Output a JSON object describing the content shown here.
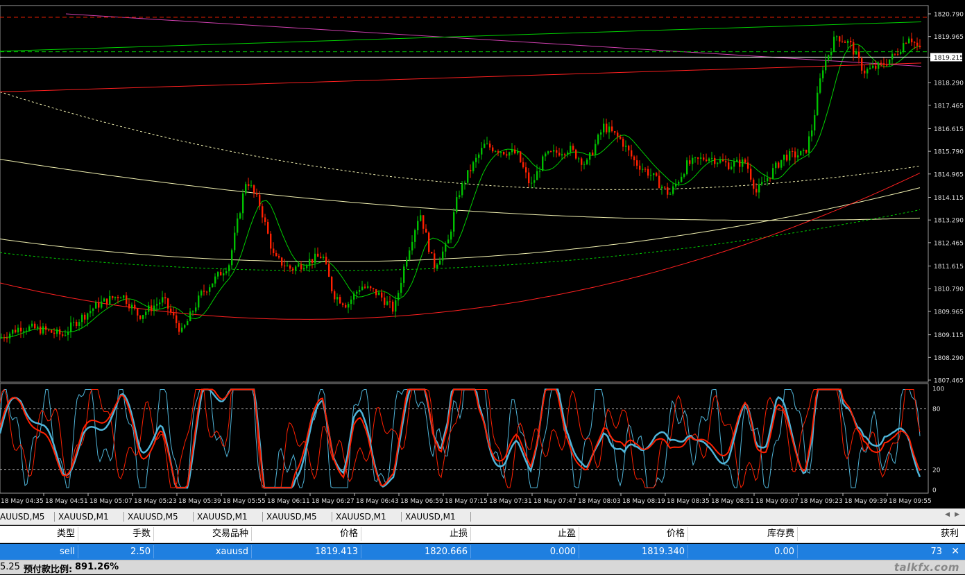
{
  "window": {
    "title": "XAUUSD,M1"
  },
  "colors": {
    "background": "#000000",
    "bull": "#00c000",
    "bear": "#ff2000",
    "ma_fast": "#00d000",
    "ma_slow": "#ff2020",
    "ma_yellow": "#f0f0b0",
    "magenta": "#d040b0",
    "signal": "#4fb4d8",
    "grid_header_bg": "#ffffff",
    "selected_row": "#1f7fe0"
  },
  "price_axis": {
    "labels": [
      "1820.790",
      "1819.965",
      "1819.215",
      "1818.290",
      "1817.465",
      "1816.615",
      "1815.790",
      "1814.965",
      "1814.115",
      "1813.290",
      "1812.465",
      "1811.615",
      "1810.790",
      "1809.965",
      "1809.115",
      "1808.290",
      "1807.465"
    ],
    "current_price": "1819.215"
  },
  "oscillator_axis": {
    "labels": [
      "100",
      "80",
      "20",
      "0"
    ]
  },
  "time_axis": {
    "labels": [
      "18 May 04:35",
      "18 May 04:51",
      "18 May 05:07",
      "18 May 05:23",
      "18 May 05:39",
      "18 May 05:55",
      "18 May 06:11",
      "18 May 06:27",
      "18 May 06:43",
      "18 May 06:59",
      "18 May 07:15",
      "18 May 07:31",
      "18 May 07:47",
      "18 May 08:03",
      "18 May 08:19",
      "18 May 08:35",
      "18 May 08:51",
      "18 May 09:07",
      "18 May 09:23",
      "18 May 09:39",
      "18 May 09:55"
    ]
  },
  "chart_data": {
    "type": "candlestick",
    "symbol": "XAUUSD",
    "timeframe": "M1",
    "ylim": [
      1807.465,
      1820.79
    ],
    "current_price": 1819.215,
    "position_open_price": 1819.413,
    "stop_loss": 1820.666,
    "price_path": [
      [
        0,
        1809.0
      ],
      [
        30,
        1809.4
      ],
      [
        60,
        1809.3
      ],
      [
        90,
        1809.1
      ],
      [
        110,
        1809.6
      ],
      [
        140,
        1810.2
      ],
      [
        175,
        1810.6
      ],
      [
        200,
        1809.8
      ],
      [
        235,
        1810.4
      ],
      [
        262,
        1809.2
      ],
      [
        290,
        1810.6
      ],
      [
        330,
        1811.7
      ],
      [
        355,
        1814.8
      ],
      [
        375,
        1813.8
      ],
      [
        395,
        1811.9
      ],
      [
        420,
        1811.5
      ],
      [
        445,
        1811.8
      ],
      [
        465,
        1812.0
      ],
      [
        480,
        1810.6
      ],
      [
        500,
        1810.2
      ],
      [
        520,
        1810.9
      ],
      [
        545,
        1810.6
      ],
      [
        568,
        1810.0
      ],
      [
        585,
        1811.9
      ],
      [
        605,
        1813.6
      ],
      [
        625,
        1811.6
      ],
      [
        645,
        1812.4
      ],
      [
        660,
        1814.2
      ],
      [
        675,
        1815.0
      ],
      [
        698,
        1816.0
      ],
      [
        725,
        1815.8
      ],
      [
        745,
        1815.7
      ],
      [
        765,
        1814.5
      ],
      [
        785,
        1815.6
      ],
      [
        820,
        1815.9
      ],
      [
        845,
        1815.3
      ],
      [
        870,
        1816.7
      ],
      [
        895,
        1816.2
      ],
      [
        915,
        1815.4
      ],
      [
        940,
        1814.9
      ],
      [
        965,
        1814.2
      ],
      [
        990,
        1815.3
      ],
      [
        1020,
        1815.6
      ],
      [
        1050,
        1815.3
      ],
      [
        1075,
        1815.4
      ],
      [
        1090,
        1814.3
      ],
      [
        1105,
        1814.8
      ],
      [
        1130,
        1815.6
      ],
      [
        1160,
        1815.7
      ],
      [
        1170,
        1816.6
      ],
      [
        1185,
        1818.8
      ],
      [
        1205,
        1820.0
      ],
      [
        1225,
        1819.7
      ],
      [
        1245,
        1818.7
      ],
      [
        1270,
        1818.9
      ],
      [
        1290,
        1819.3
      ],
      [
        1310,
        1820.0
      ],
      [
        1328,
        1819.4
      ]
    ],
    "trend_lines": [
      {
        "color": "magenta",
        "from": [
          95,
          1820.79
        ],
        "to": [
          1328,
          1818.88
        ]
      },
      {
        "color": "green",
        "from": [
          0,
          1819.43
        ],
        "to": [
          1328,
          1820.5
        ]
      },
      {
        "color": "red",
        "from": [
          0,
          1817.95
        ],
        "to": [
          1328,
          1819.0
        ]
      }
    ],
    "horizontal_levels": [
      {
        "price": 1820.666,
        "style": "dashed",
        "color": "red"
      },
      {
        "price": 1819.413,
        "style": "dashed",
        "color": "green"
      },
      {
        "price": 1819.215,
        "style": "solid",
        "color": "white"
      }
    ]
  },
  "tabs": [
    "AUUSD,M5",
    "XAUUSD,M1",
    "XAUUSD,M5",
    "XAUUSD,M1",
    "XAUUSD,M5",
    "XAUUSD,M1",
    "XAUUSD,M1"
  ],
  "orders": {
    "columns": [
      "类型",
      "手数",
      "交易品种",
      "价格",
      "止损",
      "止盈",
      "价格",
      "库存费",
      "获利"
    ],
    "rows": [
      [
        "sell",
        "2.50",
        "xauusd",
        "1819.413",
        "1820.666",
        "0.000",
        "1819.340",
        "0.00",
        "73"
      ]
    ]
  },
  "status": {
    "left_value": "5.25",
    "margin_label": "预付款比例:",
    "margin_value": "891.26%"
  },
  "watermark": "talkfx.com"
}
